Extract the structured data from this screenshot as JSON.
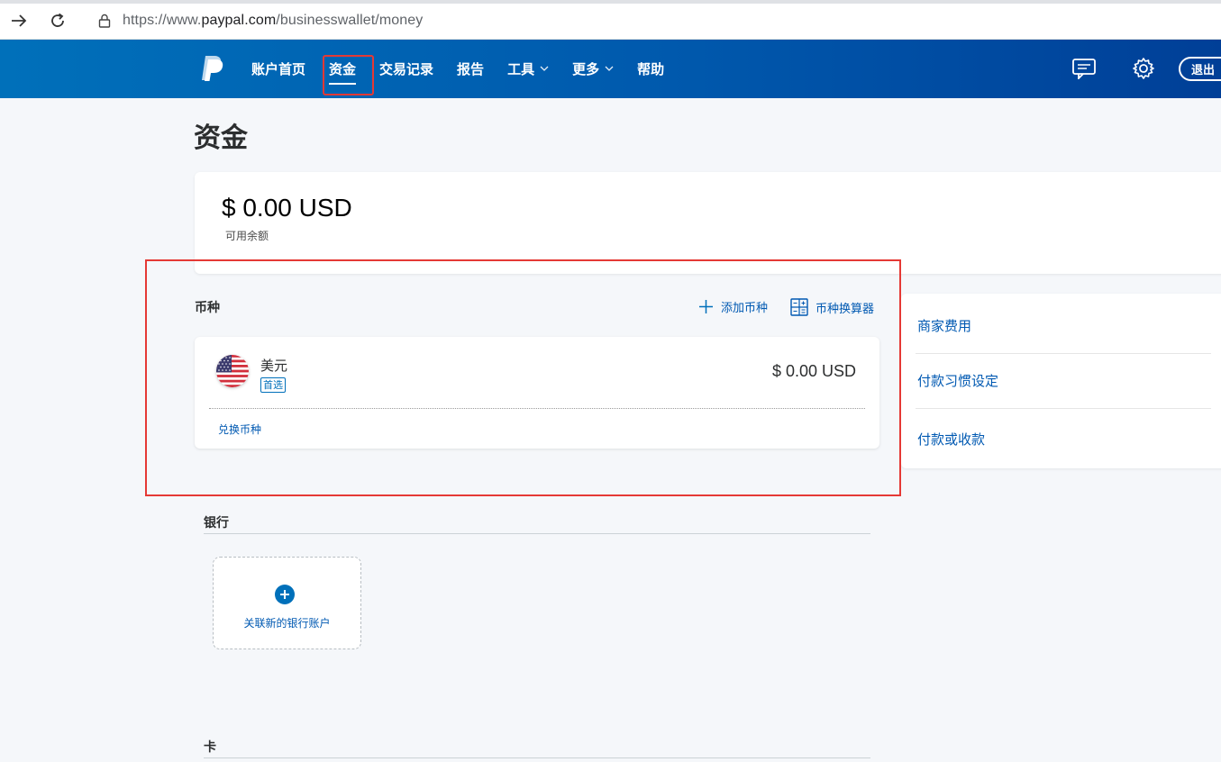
{
  "browser": {
    "url_prefix": "https://www.",
    "url_host": "paypal.com",
    "url_path": "/businesswallet/money"
  },
  "header": {
    "logo_icon": "paypal-logo",
    "nav": [
      {
        "label": "账户首页"
      },
      {
        "label": "资金",
        "active": true
      },
      {
        "label": "交易记录"
      },
      {
        "label": "报告"
      },
      {
        "label": "工具",
        "dropdown": true
      },
      {
        "label": "更多",
        "dropdown": true
      },
      {
        "label": "帮助"
      }
    ],
    "message_icon": "message-center-icon",
    "settings_icon": "gear-icon",
    "logout_label": "退出"
  },
  "page": {
    "title": "资金"
  },
  "balance": {
    "amount": "$ 0.00 USD",
    "label": "可用余额"
  },
  "currencies": {
    "title": "币种",
    "add_label": "添加币种",
    "calculator_label": "币种换算器",
    "items": [
      {
        "name": "美元",
        "badge": "首选",
        "amount": "$ 0.00 USD",
        "flag_icon": "us-flag-icon"
      }
    ],
    "convert_label": "兑换币种"
  },
  "side_links": [
    {
      "label": "商家费用"
    },
    {
      "label": "付款习惯设定"
    },
    {
      "label": "付款或收款"
    }
  ],
  "bank": {
    "title": "银行",
    "add_label": "关联新的银行账户"
  },
  "cards": {
    "title": "卡"
  },
  "colors": {
    "header_start": "#0070ba",
    "header_end": "#003f97",
    "link": "#0059b2",
    "highlight": "#e53935"
  }
}
